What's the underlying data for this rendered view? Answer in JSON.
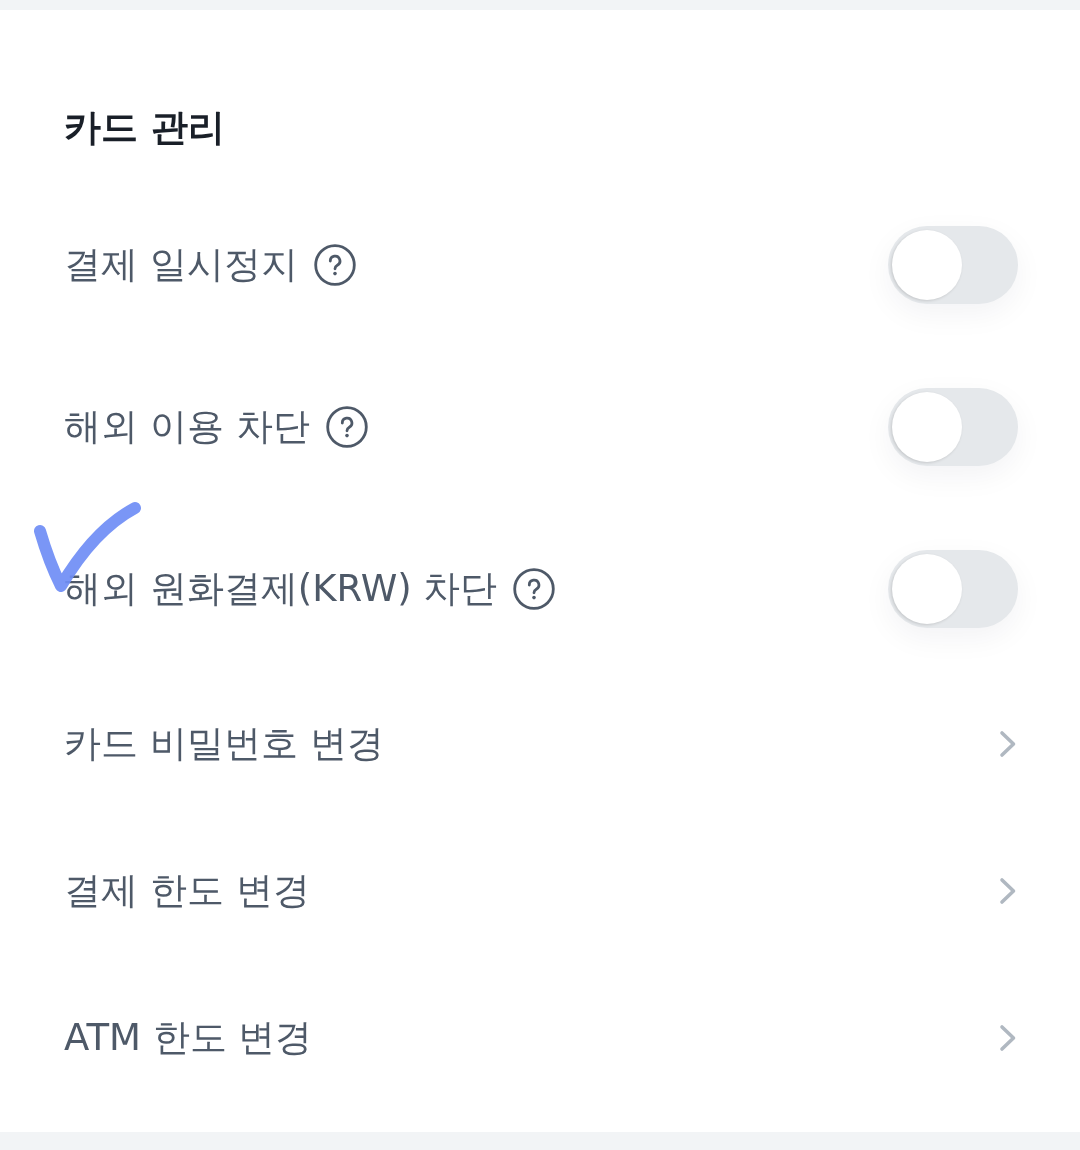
{
  "section": {
    "title": "카드 관리"
  },
  "items": [
    {
      "kind": "toggle",
      "label": "결제 일시정지",
      "help": true,
      "on": false
    },
    {
      "kind": "toggle",
      "label": "해외 이용 차단",
      "help": true,
      "on": false
    },
    {
      "kind": "toggle",
      "label": "해외 원화결제(KRW) 차단",
      "help": true,
      "on": false
    },
    {
      "kind": "link",
      "label": "카드 비밀번호 변경",
      "help": false
    },
    {
      "kind": "link",
      "label": "결제 한도 변경",
      "help": false
    },
    {
      "kind": "link",
      "label": "ATM 한도 변경",
      "help": false
    }
  ]
}
